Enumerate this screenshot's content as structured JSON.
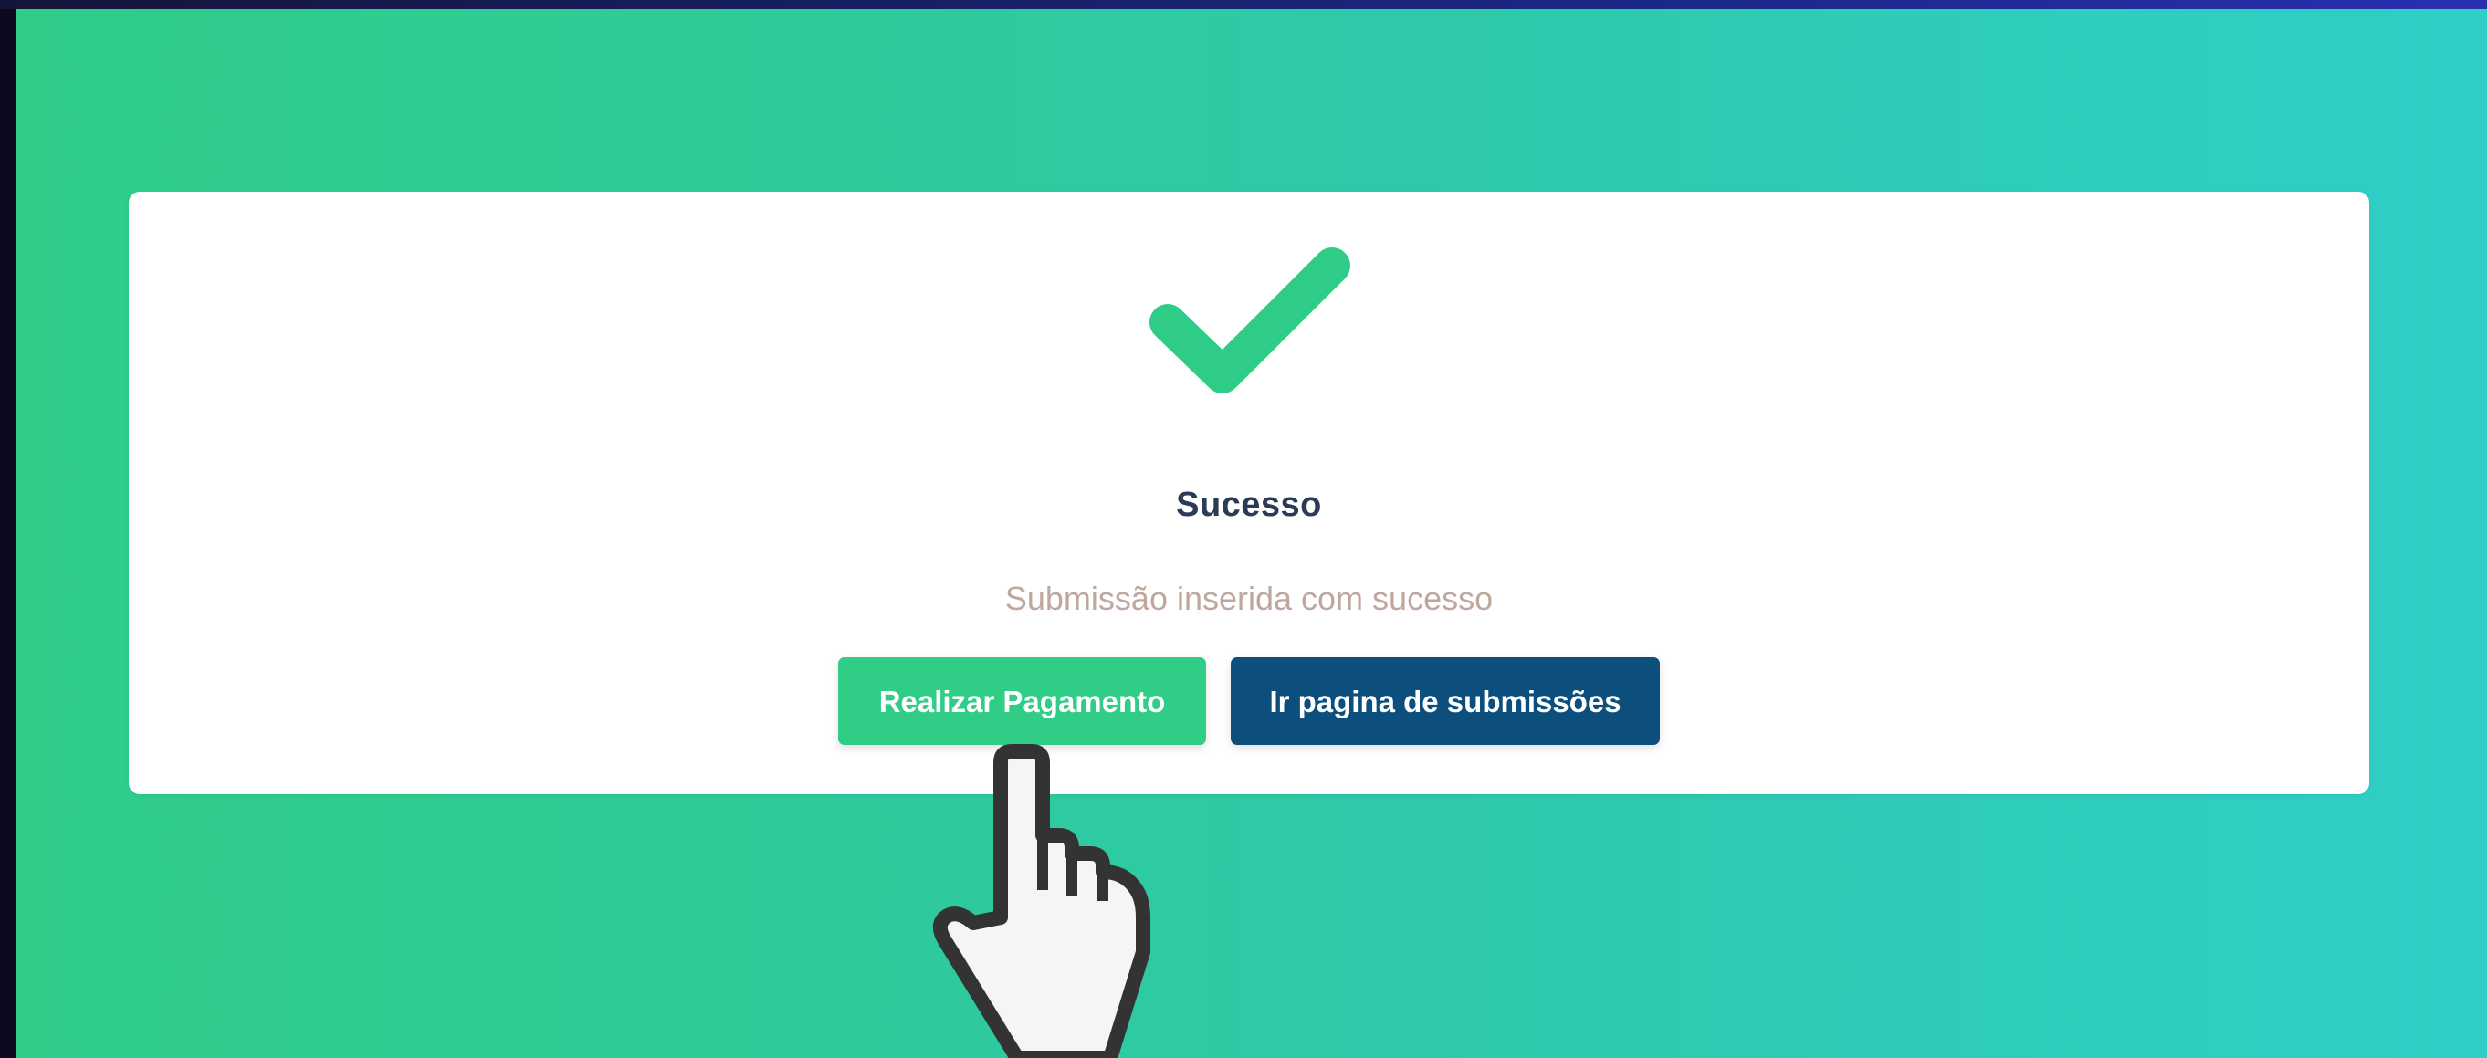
{
  "dialog": {
    "title": "Sucesso",
    "message": "Submissão inserida com sucesso",
    "icon": "check-icon",
    "icon_color": "#2ecc86"
  },
  "buttons": {
    "pay_label": "Realizar Pagamento",
    "submissions_label": "Ir pagina de submissões"
  },
  "colors": {
    "background_start": "#2fcd88",
    "background_end": "#2fcfc8",
    "pay_button": "#2fcd86",
    "submissions_button": "#0c4f7c"
  },
  "cursor": {
    "icon": "hand-pointer-icon"
  }
}
